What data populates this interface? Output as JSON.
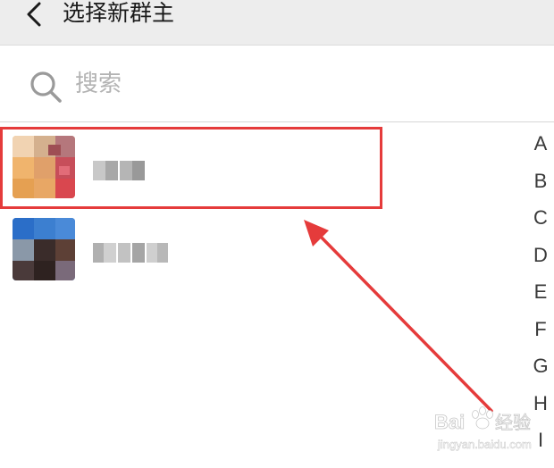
{
  "header": {
    "title": "选择新群主"
  },
  "search": {
    "placeholder": "搜索"
  },
  "contacts": [
    {
      "name": "",
      "avatar": "pixelated-photo"
    },
    {
      "name": "",
      "avatar": "pixelated-photo"
    }
  ],
  "alpha_index": [
    "A",
    "B",
    "C",
    "D",
    "E",
    "F",
    "G",
    "H",
    "I"
  ],
  "watermark": {
    "text": "Bai Du 经验",
    "url": "jingyan.baidu.com"
  },
  "colors": {
    "header_bg": "#ededed",
    "highlight": "#e53b3b",
    "background": "#ffffff"
  }
}
